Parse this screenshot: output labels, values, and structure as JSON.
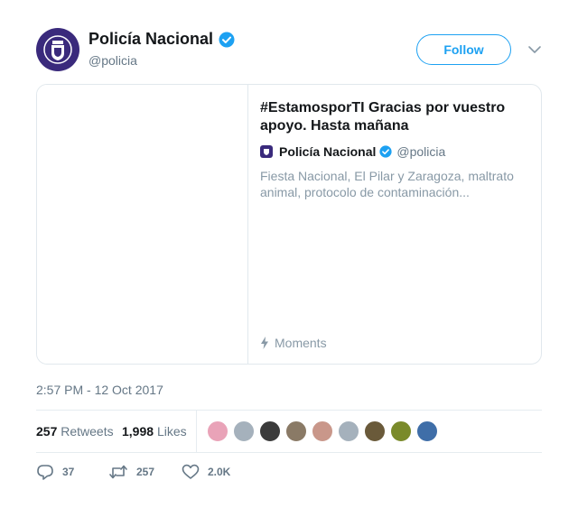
{
  "account": {
    "name": "Policía Nacional",
    "handle": "@policia",
    "avatar_icon": "police-shield-logo",
    "verified_icon": "verified-badge-icon",
    "follow_label": "Follow",
    "menu_icon": "chevron-down-icon"
  },
  "card": {
    "title": "#EstamosporTI Gracias por vuestro apoyo. Hasta mañana",
    "author_name": "Policía Nacional",
    "author_handle": "@policia",
    "description": "Fiesta Nacional, El Pilar y Zaragoza, maltrato animal, protocolo de contaminación...",
    "footer_label": "Moments",
    "footer_icon": "lightning-icon"
  },
  "timestamp": "2:57 PM - 12 Oct 2017",
  "stats": {
    "retweets_count": "257",
    "retweets_label": "Retweets",
    "likes_count": "1,998",
    "likes_label": "Likes",
    "likers": [
      {
        "color": "#e9a3b8"
      },
      {
        "color": "#a5b1bc"
      },
      {
        "color": "#3b3b3b"
      },
      {
        "color": "#8a7a66"
      },
      {
        "color": "#c9978a"
      },
      {
        "color": "#a5b1bc"
      },
      {
        "color": "#6a5a3a"
      },
      {
        "color": "#7a8a2a"
      },
      {
        "color": "#3f6ea8"
      }
    ]
  },
  "actions": {
    "reply_icon": "reply-icon",
    "reply_count": "37",
    "retweet_icon": "retweet-icon",
    "retweet_count": "257",
    "like_icon": "heart-icon",
    "like_count": "2.0K"
  },
  "colors": {
    "accent": "#1da1f2",
    "brand": "#3a2a7c",
    "muted": "#657786",
    "border": "#e1e8ed"
  }
}
